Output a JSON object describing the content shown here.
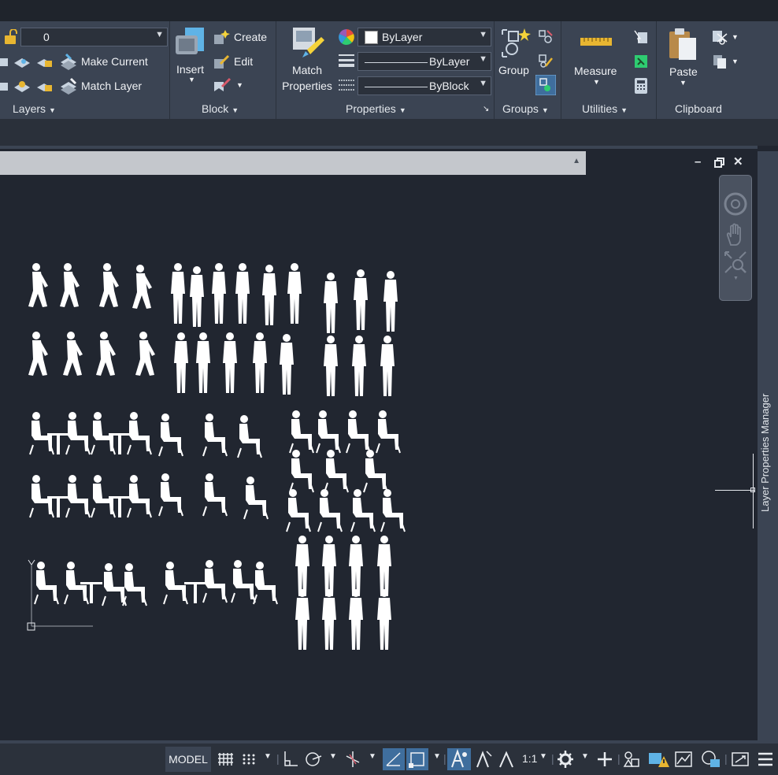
{
  "ribbon": {
    "layers": {
      "current_layer": "0",
      "make_current": "Make Current",
      "match_layer": "Match Layer",
      "title": "Layers"
    },
    "block": {
      "insert": "Insert",
      "create": "Create",
      "edit": "Edit",
      "title": "Block"
    },
    "properties": {
      "match_properties_line1": "Match",
      "match_properties_line2": "Properties",
      "color": "ByLayer",
      "linetype": "ByLayer",
      "lineweight": "ByBlock",
      "title": "Properties"
    },
    "groups": {
      "group": "Group",
      "title": "Groups"
    },
    "utilities": {
      "measure": "Measure",
      "title": "Utilities"
    },
    "clipboard": {
      "paste": "Paste",
      "title": "Clipboard"
    }
  },
  "side_panel": {
    "title": "Layer Properties Manager"
  },
  "status_bar": {
    "model": "MODEL",
    "scale": "1:1"
  },
  "colors": {
    "ribbon_bg": "#3b4453",
    "canvas_bg": "#212630",
    "active_toggle": "#3f6e9d"
  }
}
